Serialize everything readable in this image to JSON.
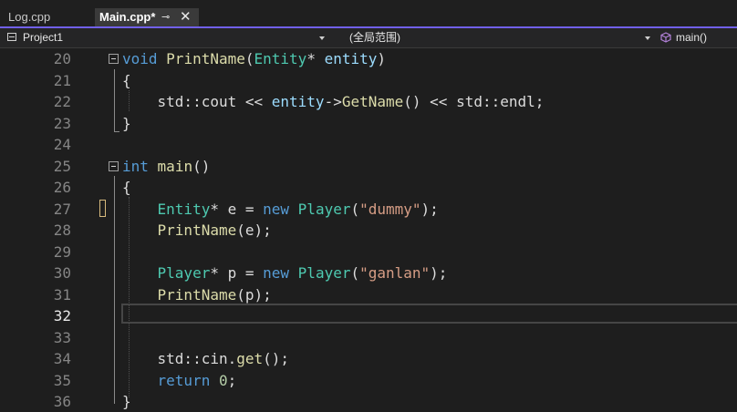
{
  "tabs": [
    {
      "label": "Log.cpp",
      "active": false
    },
    {
      "label": "Main.cpp*",
      "active": true,
      "pin_glyph": "⊸",
      "close_glyph": "✕"
    }
  ],
  "navbar": {
    "project": "Project1",
    "scope": "(全局范围)",
    "function": "main()"
  },
  "colors": {
    "accent": "#7160e8",
    "keyword": "#569cd6",
    "type": "#4ec9b0",
    "function": "#dcdcaa",
    "string": "#d69d85",
    "parameter": "#9cdcfe",
    "number": "#b5cea8",
    "plain": "#dcdcdc",
    "line_number": "#858585",
    "change_marker": "#d7ba7d"
  },
  "editor": {
    "current_line": "32",
    "line_numbers": [
      "20",
      "21",
      "22",
      "23",
      "24",
      "25",
      "26",
      "27",
      "28",
      "29",
      "30",
      "31",
      "32",
      "33",
      "34",
      "35",
      "36"
    ],
    "code_lines": [
      [
        {
          "t": "void",
          "c": "kw"
        },
        {
          "t": " "
        },
        {
          "t": "PrintName",
          "c": "fn"
        },
        {
          "t": "("
        },
        {
          "t": "Entity",
          "c": "ty"
        },
        {
          "t": "* "
        },
        {
          "t": "entity",
          "c": "par"
        },
        {
          "t": ")"
        }
      ],
      [
        {
          "t": "{"
        }
      ],
      [
        {
          "t": "    std::cout << "
        },
        {
          "t": "entity",
          "c": "par"
        },
        {
          "t": "->"
        },
        {
          "t": "GetName",
          "c": "fn"
        },
        {
          "t": "() << std::endl;"
        }
      ],
      [
        {
          "t": "}"
        }
      ],
      [],
      [
        {
          "t": "int",
          "c": "kw"
        },
        {
          "t": " "
        },
        {
          "t": "main",
          "c": "fn"
        },
        {
          "t": "()"
        }
      ],
      [
        {
          "t": "{"
        }
      ],
      [
        {
          "t": "    "
        },
        {
          "t": "Entity",
          "c": "ty"
        },
        {
          "t": "* e = "
        },
        {
          "t": "new",
          "c": "kw"
        },
        {
          "t": " "
        },
        {
          "t": "Player",
          "c": "ty"
        },
        {
          "t": "("
        },
        {
          "t": "\"dummy\"",
          "c": "st"
        },
        {
          "t": ");"
        }
      ],
      [
        {
          "t": "    "
        },
        {
          "t": "PrintName",
          "c": "fn"
        },
        {
          "t": "(e);"
        }
      ],
      [],
      [
        {
          "t": "    "
        },
        {
          "t": "Player",
          "c": "ty"
        },
        {
          "t": "* p = "
        },
        {
          "t": "new",
          "c": "kw"
        },
        {
          "t": " "
        },
        {
          "t": "Player",
          "c": "ty"
        },
        {
          "t": "("
        },
        {
          "t": "\"ganlan\"",
          "c": "st"
        },
        {
          "t": ");"
        }
      ],
      [
        {
          "t": "    "
        },
        {
          "t": "PrintName",
          "c": "fn"
        },
        {
          "t": "(p);"
        }
      ],
      [],
      [],
      [
        {
          "t": "    std::cin."
        },
        {
          "t": "get",
          "c": "fn"
        },
        {
          "t": "();"
        }
      ],
      [
        {
          "t": "    "
        },
        {
          "t": "return",
          "c": "kw"
        },
        {
          "t": " "
        },
        {
          "t": "0",
          "c": "nm"
        },
        {
          "t": ";"
        }
      ],
      [
        {
          "t": "}"
        }
      ]
    ]
  }
}
